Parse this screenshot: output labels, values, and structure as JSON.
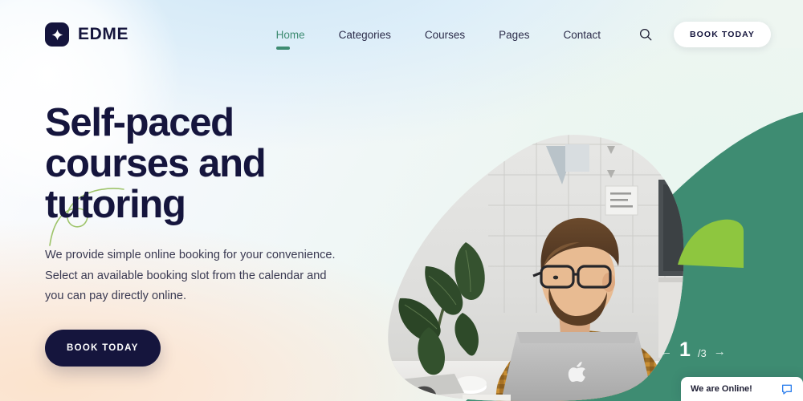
{
  "brand": {
    "name": "EDME",
    "logo_icon": "diamond-star-icon"
  },
  "nav": {
    "items": [
      {
        "label": "Home",
        "active": true
      },
      {
        "label": "Categories",
        "active": false
      },
      {
        "label": "Courses",
        "active": false
      },
      {
        "label": "Pages",
        "active": false
      },
      {
        "label": "Contact",
        "active": false
      }
    ],
    "search_icon": "search-icon",
    "cta_label": "BOOK TODAY"
  },
  "hero": {
    "heading_lines": [
      "Self-paced",
      "courses and",
      "tutoring"
    ],
    "paragraph": "We provide simple online booking for your convenience. Select an available booking slot from the calendar and you can pay directly online.",
    "cta_label": "BOOK TODAY"
  },
  "slider": {
    "prev_icon": "arrow-left-icon",
    "next_icon": "arrow-right-icon",
    "current": "1",
    "total": "/3"
  },
  "chat": {
    "text": "We are Online!",
    "icon": "chat-bubble-icon"
  },
  "colors": {
    "navy": "#15153d",
    "teal": "#3e8c72",
    "lime": "#8ec63f",
    "chat_blue": "#2f80ed",
    "peach": "#fbe3cd",
    "sky": "#cfe6f6",
    "mint": "#eef7f2"
  }
}
